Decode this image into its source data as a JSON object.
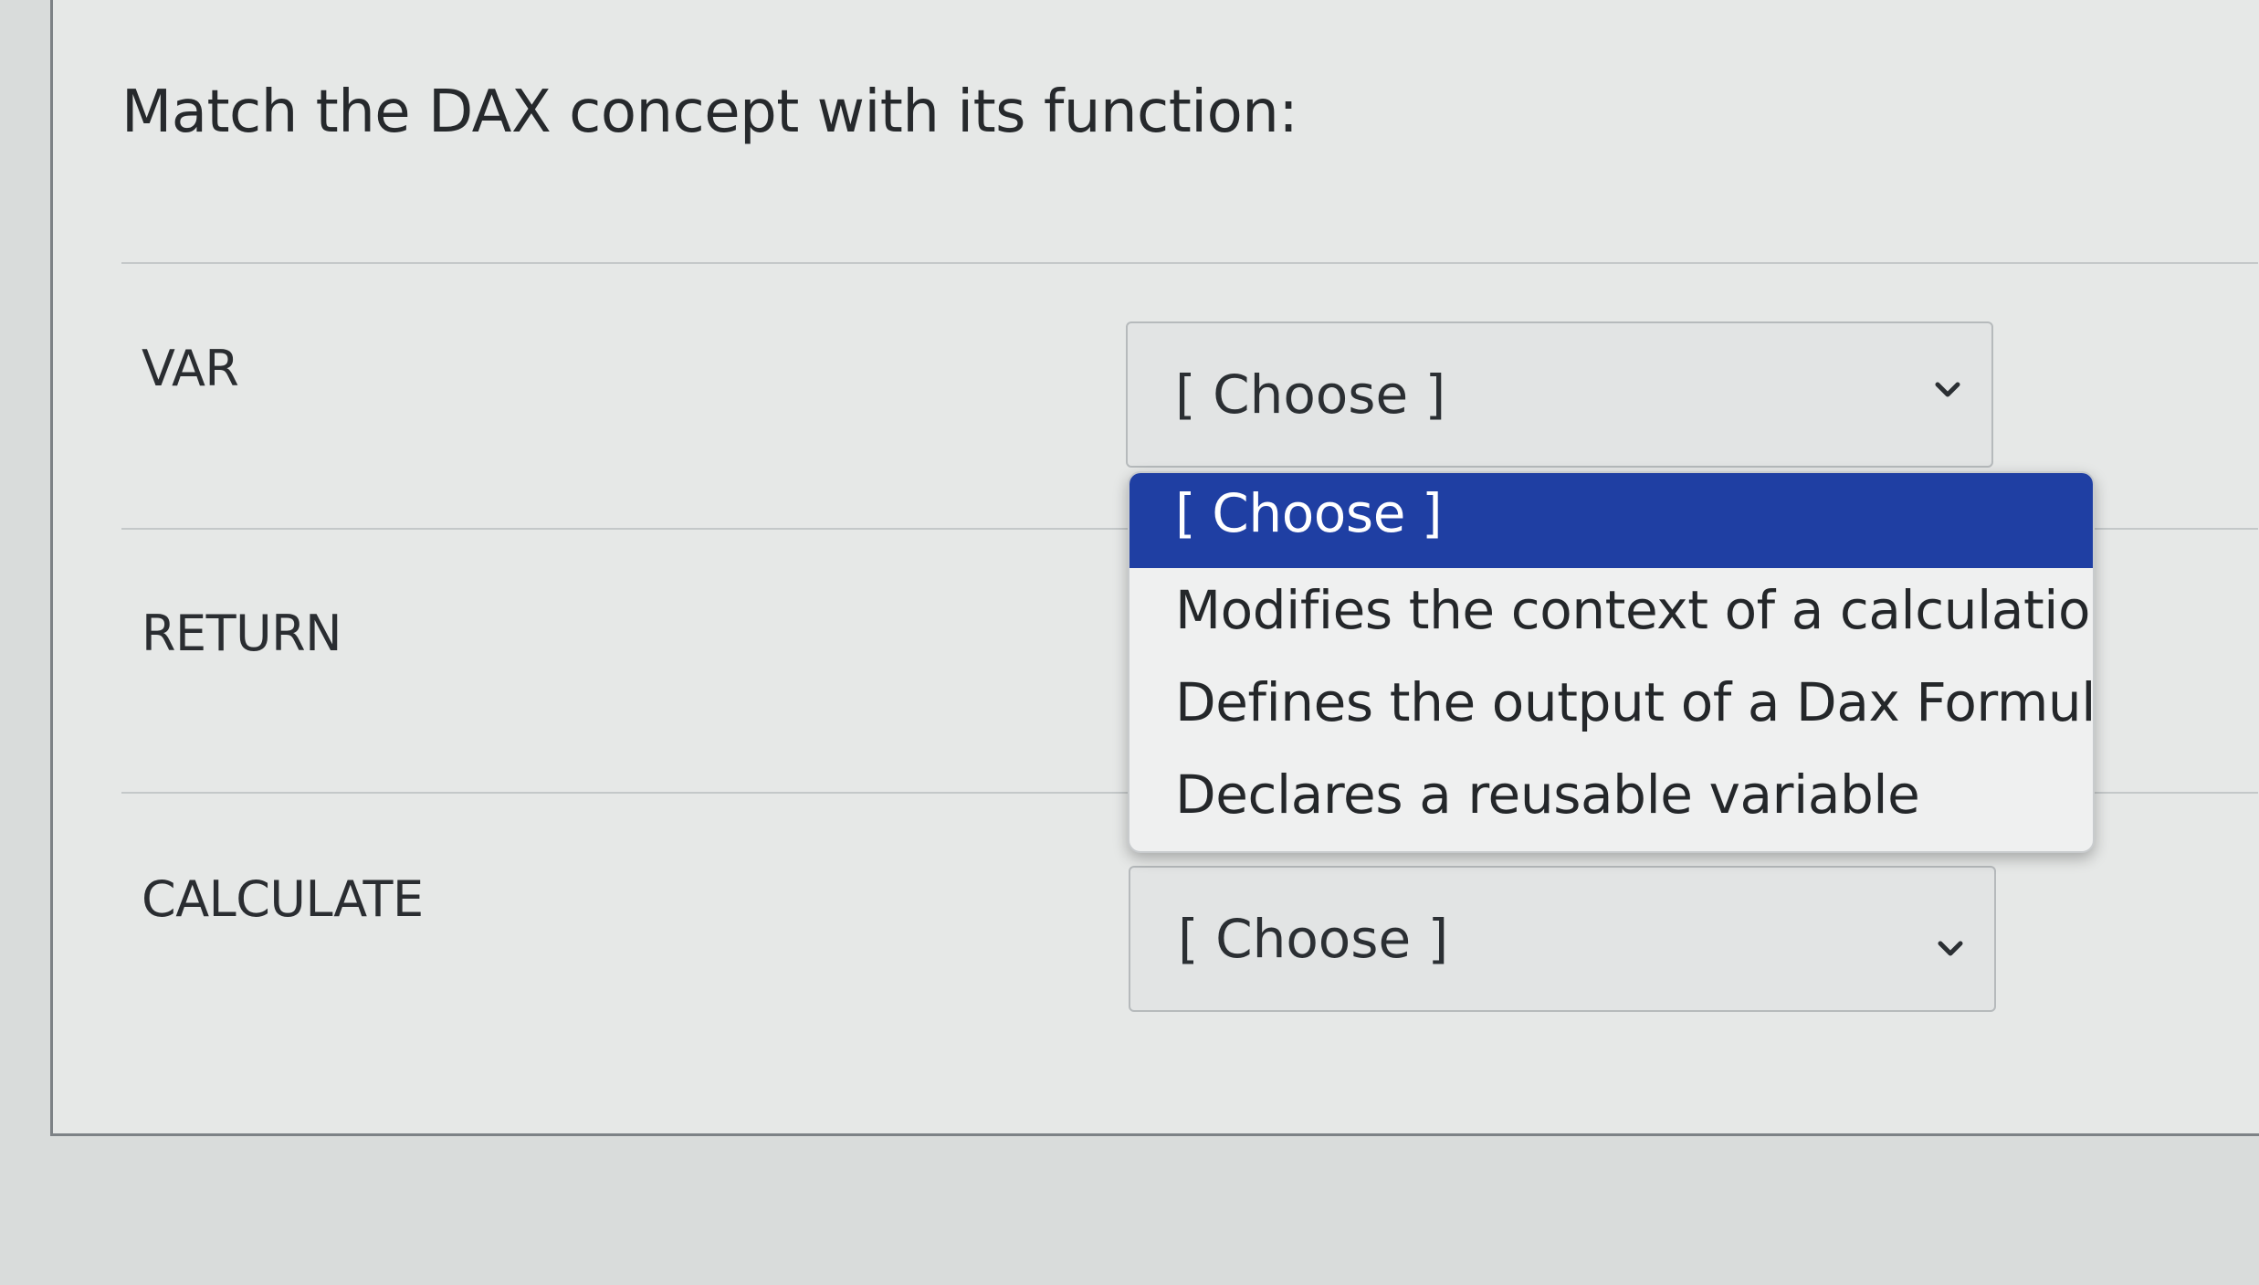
{
  "question": {
    "title": "Match the DAX concept with its function:"
  },
  "rows": [
    {
      "concept": "VAR",
      "selected_value": "[ Choose ]"
    },
    {
      "concept": "RETURN",
      "selected_value": "[ Choose ]"
    },
    {
      "concept": "CALCULATE",
      "selected_value": "[ Choose ]"
    }
  ],
  "dropdown": {
    "options": [
      "[ Choose ]",
      "Modifies the context of a calculation",
      "Defines the output of a Dax Formula",
      "Declares a reusable variable"
    ],
    "highlighted_index": 0
  },
  "colors": {
    "highlight": "#1f3fa3",
    "background": "#e6e8e7",
    "text": "#2b2f33"
  },
  "icons": {
    "select_arrow": "chevron-down-icon"
  }
}
